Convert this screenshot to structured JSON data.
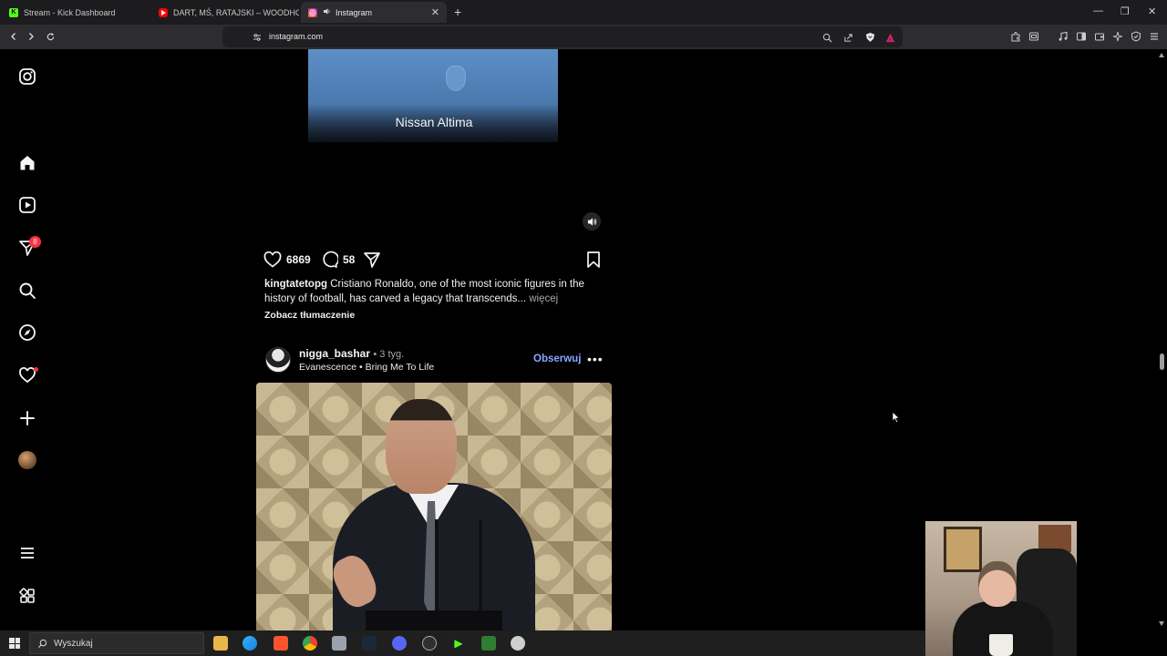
{
  "browser": {
    "tabs": [
      {
        "title": "Stream - Kick Dashboard",
        "favicon": "kick-icon",
        "color": "#53fc18"
      },
      {
        "title": "DART, MŚ, RATAJSKI – WOODHOUSE",
        "favicon": "youtube-icon",
        "color": "#ff0000"
      },
      {
        "title": "Instagram",
        "favicon": "instagram-icon",
        "color": "#e1306c",
        "audio": true
      }
    ],
    "url": "instagram.com"
  },
  "sidebar": {
    "items": [
      {
        "name": "instagram-logo-icon"
      },
      {
        "name": "home-icon"
      },
      {
        "name": "reels-icon"
      },
      {
        "name": "direct-messages-icon",
        "badge": "8"
      },
      {
        "name": "search-icon"
      },
      {
        "name": "explore-icon"
      },
      {
        "name": "notifications-icon"
      },
      {
        "name": "create-icon"
      },
      {
        "name": "profile-avatar"
      },
      {
        "name": "menu-icon"
      },
      {
        "name": "meta-apps-icon"
      }
    ]
  },
  "post1": {
    "overlay_text": "Nissan Altima",
    "likes": "6869",
    "comments": "58",
    "username": "kingtatetopg",
    "caption": "Cristiano Ronaldo, one of the most iconic figures in the history of football, has carved a legacy that transcends...",
    "more_label": "więcej",
    "translate_label": "Zobacz tłumaczenie"
  },
  "post2": {
    "username": "nigga_bashar",
    "age": "3 tyg.",
    "music_artist": "Evanescence",
    "music_title": "Bring Me To Life",
    "follow_label": "Obserwuj"
  },
  "taskbar": {
    "search_placeholder": "Wyszukaj"
  },
  "colors": {
    "accent_follow": "#8aa7ff",
    "badge_red": "#ff3040",
    "background": "#000000"
  }
}
